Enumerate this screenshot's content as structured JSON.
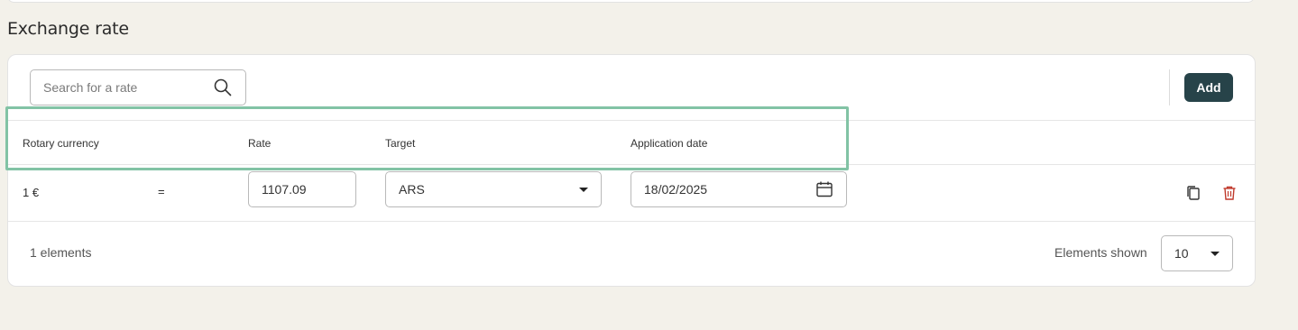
{
  "section": {
    "title": "Exchange rate"
  },
  "toolbar": {
    "search_placeholder": "Search for a rate",
    "add_label": "Add"
  },
  "table": {
    "columns": [
      "Rotary currency",
      "Rate",
      "Target",
      "Application date"
    ],
    "rows": [
      {
        "source": "1 €",
        "equals": "=",
        "rate": "1107.09",
        "target": "ARS",
        "date": "18/02/2025"
      }
    ]
  },
  "footer": {
    "count_text": "1 elements",
    "shown_label": "Elements shown",
    "page_size": "10"
  },
  "icons": {
    "search": "search-icon",
    "dropdown": "caret-down-icon",
    "calendar": "calendar-icon",
    "copy": "copy-icon",
    "delete": "trash-icon"
  },
  "colors": {
    "accent": "#274349",
    "highlight": "#82c3a5",
    "delete": "#c0392b"
  }
}
